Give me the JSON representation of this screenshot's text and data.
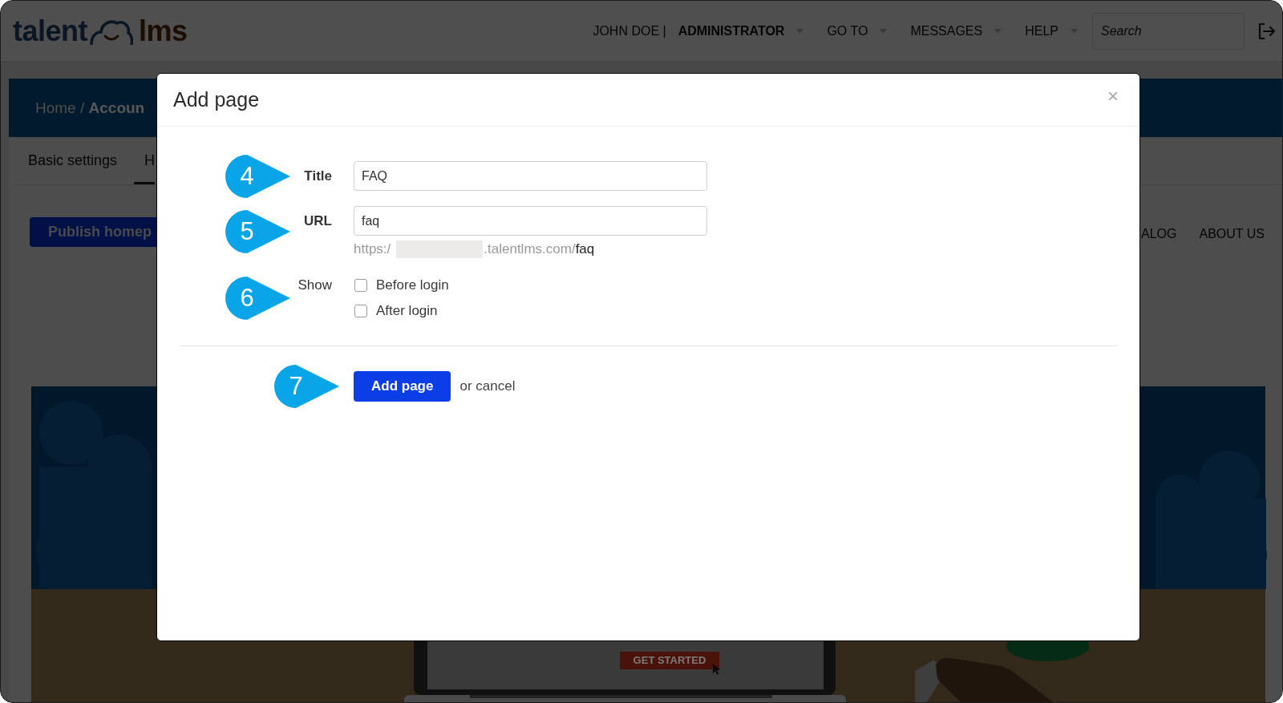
{
  "header": {
    "logo": {
      "left": "talent",
      "right": "lms"
    },
    "nav": [
      {
        "label": "JOHN DOE | **ADMINISTRATOR**"
      },
      {
        "label": "GO TO"
      },
      {
        "label": "MESSAGES"
      },
      {
        "label": "HELP"
      }
    ],
    "search": {
      "placeholder": "Search"
    }
  },
  "page": {
    "breadcrumb": "Home / **Accoun**",
    "tabs": [
      {
        "label": "Basic settings",
        "selected": false
      },
      {
        "label": "H",
        "selected": true
      }
    ],
    "publish_button": "Publish homep",
    "site_menu": [
      "ALOG",
      "ABOUT US"
    ],
    "hero": {
      "button": "GET STARTED"
    }
  },
  "dialog": {
    "title": "Add page",
    "close": "×",
    "fields": [
      {
        "kind": "text",
        "callout": "4",
        "label": "Title",
        "value": "FAQ"
      },
      {
        "kind": "text",
        "callout": "5",
        "label": "URL",
        "value": "faq",
        "hint": {
          "prefix": "https:/",
          "domain": ".talentlms.com/",
          "slug": "faq"
        }
      },
      {
        "kind": "checks",
        "callout": "6",
        "label": "Show",
        "options": [
          {
            "label": "Before login",
            "checked": false
          },
          {
            "label": "After login",
            "checked": false
          }
        ]
      }
    ],
    "actions": {
      "callout": "7",
      "submit": "Add page",
      "cancel": "or cancel"
    }
  }
}
